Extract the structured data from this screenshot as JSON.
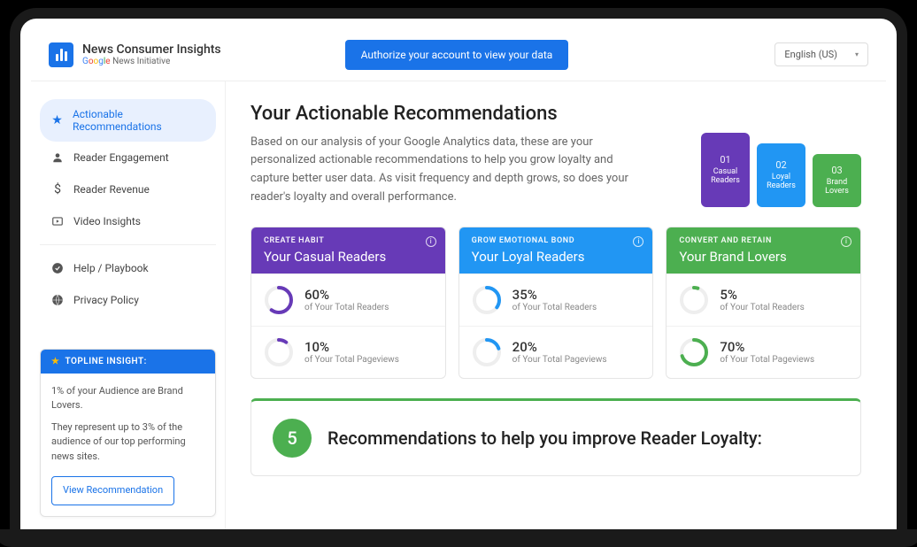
{
  "brand": {
    "title": "News Consumer Insights",
    "sub": " News Initiative"
  },
  "header": {
    "authorize": "Authorize your account to view your data",
    "language": "English (US)"
  },
  "nav": {
    "items": [
      {
        "label": "Actionable Recommendations"
      },
      {
        "label": "Reader Engagement"
      },
      {
        "label": "Reader Revenue"
      },
      {
        "label": "Video Insights"
      },
      {
        "label": "Help / Playbook"
      },
      {
        "label": "Privacy Policy"
      }
    ]
  },
  "insight": {
    "heading": "TOPLINE INSIGHT:",
    "line1": "1% of your Audience are Brand Lovers.",
    "line2": "They represent up to 3% of the audience of our top performing news sites.",
    "button": "View Recommendation"
  },
  "hero": {
    "title": "Your Actionable Recommendations",
    "body": "Based on our analysis of your Google Analytics data, these are your personalized actionable recommendations to help you grow loyalty and capture better user data. As visit frequency and depth grows, so does your reader's loyalty and overall performance."
  },
  "tiles": [
    {
      "num": "01",
      "label": "Casual Readers"
    },
    {
      "num": "02",
      "label": "Loyal Readers"
    },
    {
      "num": "03",
      "label": "Brand Lovers"
    }
  ],
  "cards": [
    {
      "category": "CREATE HABIT",
      "title": "Your Casual Readers",
      "color": "#673ab7",
      "stats": [
        {
          "value": "60%",
          "label": "of Your Total Readers",
          "pct": 60
        },
        {
          "value": "10%",
          "label": "of Your Total Pageviews",
          "pct": 10
        }
      ]
    },
    {
      "category": "GROW EMOTIONAL BOND",
      "title": "Your Loyal Readers",
      "color": "#2196f3",
      "stats": [
        {
          "value": "35%",
          "label": "of Your Total Readers",
          "pct": 35
        },
        {
          "value": "20%",
          "label": "of Your Total Pageviews",
          "pct": 20
        }
      ]
    },
    {
      "category": "CONVERT AND RETAIN",
      "title": "Your Brand Lovers",
      "color": "#4caf50",
      "stats": [
        {
          "value": "5%",
          "label": "of Your Total Readers",
          "pct": 5
        },
        {
          "value": "70%",
          "label": "of Your Total Pageviews",
          "pct": 70
        }
      ]
    }
  ],
  "recommendations": {
    "count": "5",
    "title": "Recommendations to help you improve Reader Loyalty:"
  }
}
